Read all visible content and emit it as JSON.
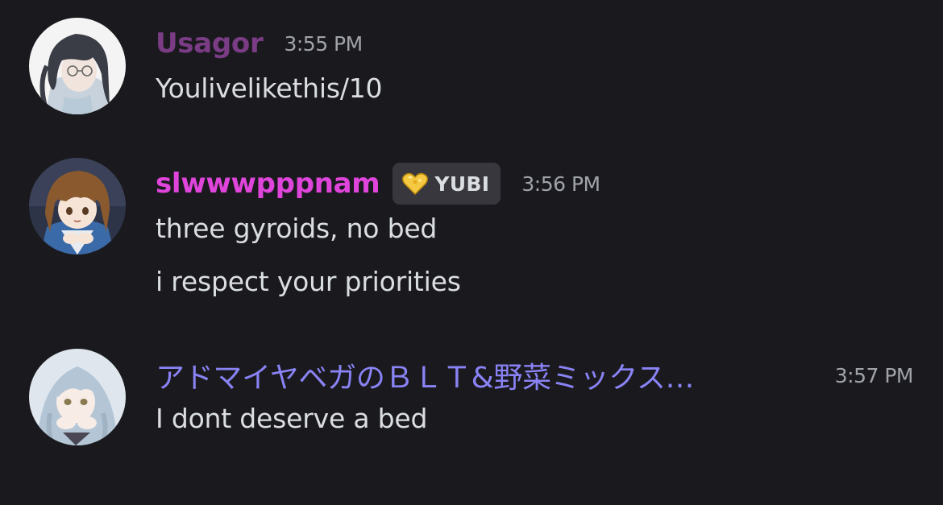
{
  "messages": [
    {
      "username": "Usagor",
      "username_color": "#7a3c85",
      "timestamp": "3:55 PM",
      "avatar_icon": "anime-girl-glasses-avatar",
      "lines": [
        "Youlivelikethis/10"
      ]
    },
    {
      "username": "slwwwpppnam",
      "username_color": "#e045db",
      "timestamp": "3:56 PM",
      "avatar_icon": "anime-girl-brown-hair-avatar",
      "badge": {
        "icon": "gold-heart-icon",
        "label": "YUBI"
      },
      "lines": [
        "three gyroids, no bed",
        "i respect your priorities"
      ]
    },
    {
      "username": "アドマイヤベガのＢＬＴ&野菜ミックス…",
      "username_color": "#8a83f5",
      "timestamp": "3:57 PM",
      "avatar_icon": "anime-girl-silver-hair-avatar",
      "lines": [
        "I dont deserve a bed"
      ]
    }
  ]
}
